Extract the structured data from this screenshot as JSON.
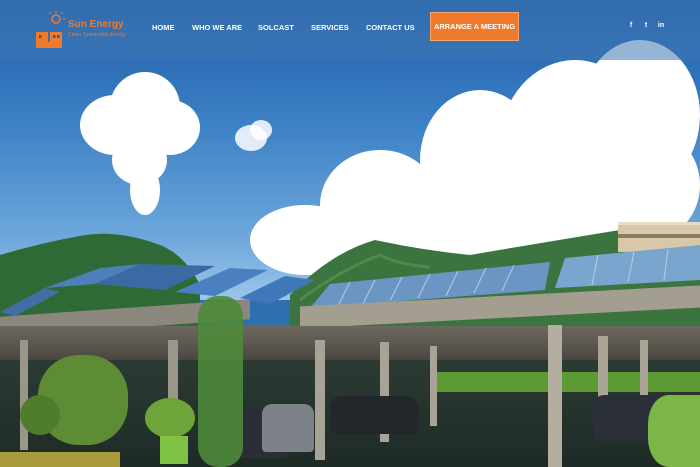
{
  "brand": {
    "name": "Sun Energy",
    "tagline": "Clean Sustainable Energy",
    "accent_color": "#f07a2c"
  },
  "nav": {
    "items": [
      {
        "label": "HOME"
      },
      {
        "label": "WHO WE ARE"
      },
      {
        "label": "SOLCAST"
      },
      {
        "label": "SERVICES"
      },
      {
        "label": "CONTACT US"
      }
    ],
    "cta_label": "ARRANGE A MEETING"
  },
  "social": [
    {
      "icon": "facebook-icon",
      "glyph": "f"
    },
    {
      "icon": "twitter-icon",
      "glyph": "t"
    },
    {
      "icon": "linkedin-icon",
      "glyph": "in"
    }
  ],
  "hero": {
    "image": "solar-panel-carport-under-blue-sky"
  }
}
